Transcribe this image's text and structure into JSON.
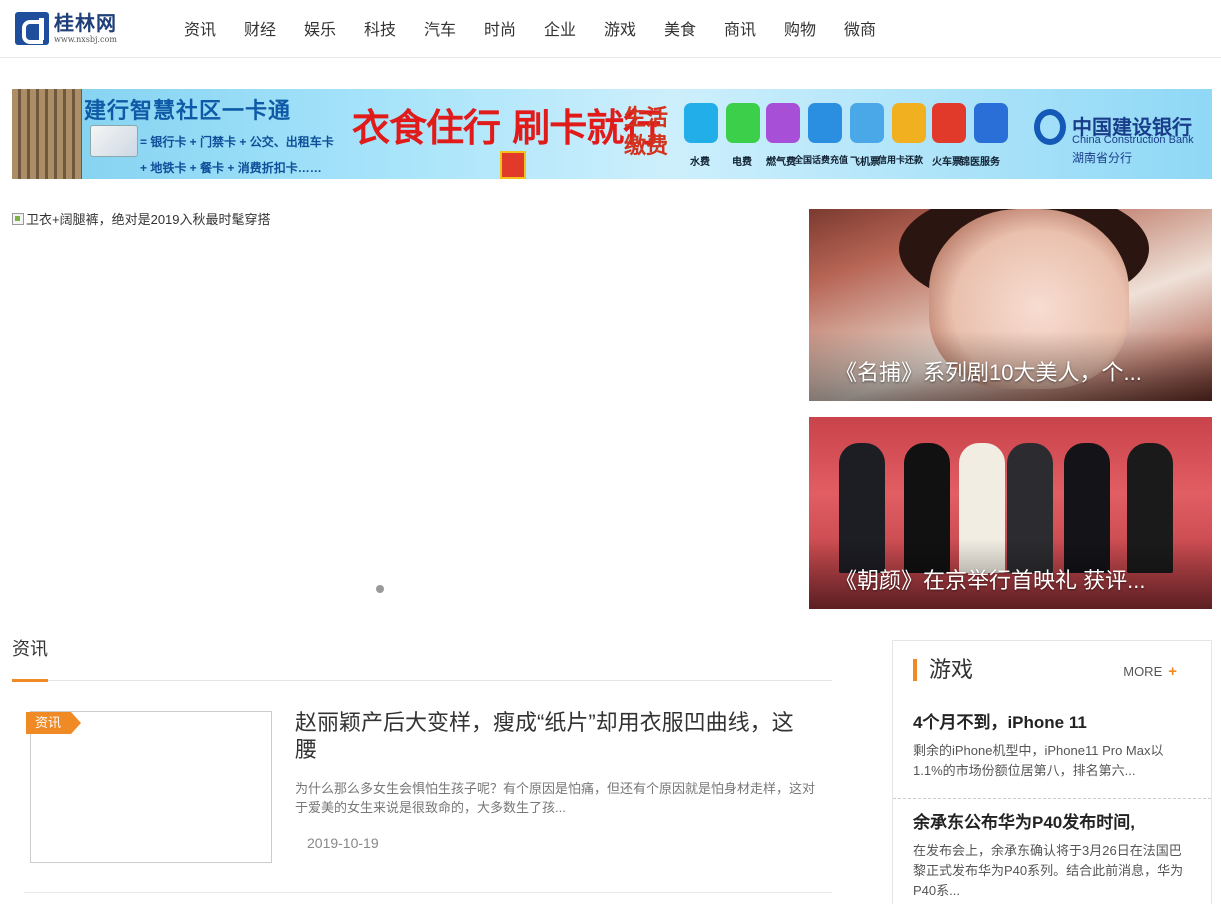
{
  "site": {
    "logo_cn": "桂林网",
    "logo_url": "www.nxsbj.com"
  },
  "nav": [
    "资讯",
    "财经",
    "娱乐",
    "科技",
    "汽车",
    "时尚",
    "企业",
    "游戏",
    "美食",
    "商讯",
    "购物",
    "微商"
  ],
  "banner": {
    "title": "建行智慧社区一卡通",
    "line1": "= 银行卡 + 门禁卡 + 公交、出租车卡",
    "line2": "+ 地铁卡 + 餐卡 + 消费折扣卡……",
    "slogan": "衣食住行 刷卡就行",
    "life": "生活缴费",
    "services": [
      "水费",
      "电费",
      "燃气费",
      "全国话费充值",
      "飞机票",
      "信用卡还款",
      "火车票",
      "锦医服务"
    ],
    "service_colors": [
      "#22aee8",
      "#3ccf4a",
      "#a84fd8",
      "#2a8fe0",
      "#4aa8e8",
      "#f0b020",
      "#e23a2a",
      "#2a6fd8"
    ],
    "bank_cn": "中国建设银行",
    "bank_en": "China Construction Bank",
    "bank_branch": "湖南省分行"
  },
  "slider": {
    "alt": "卫衣+阔腿裤，绝对是2019入秋最时髦穿搭"
  },
  "features": [
    {
      "caption": "《名捕》系列剧10大美人，个..."
    },
    {
      "caption": "《朝颜》在京举行首映礼 获评..."
    }
  ],
  "section": {
    "title": "资讯"
  },
  "article": {
    "tag": "资讯",
    "title": "赵丽颖产后大变样，瘦成“纸片”却用衣服凹曲线，这腰",
    "desc": "为什么那么多女生会惧怕生孩子呢？有个原因是怕痛，但还有个原因就是怕身材走样，这对于爱美的女生来说是很致命的，大多数生了孩...",
    "date": "2019-10-19"
  },
  "side": {
    "title": "游戏",
    "more": "MORE",
    "more_icon": "+",
    "items": [
      {
        "title": "4个月不到，iPhone 11",
        "desc": "剩余的iPhone机型中，iPhone11 Pro Max以1.1%的市场份额位居第八，排名第六..."
      },
      {
        "title": "余承东公布华为P40发布时间,",
        "desc": "在发布会上，余承东确认将于3月26日在法国巴黎正式发布华为P40系列。结合此前消息，华为P40系..."
      }
    ]
  }
}
